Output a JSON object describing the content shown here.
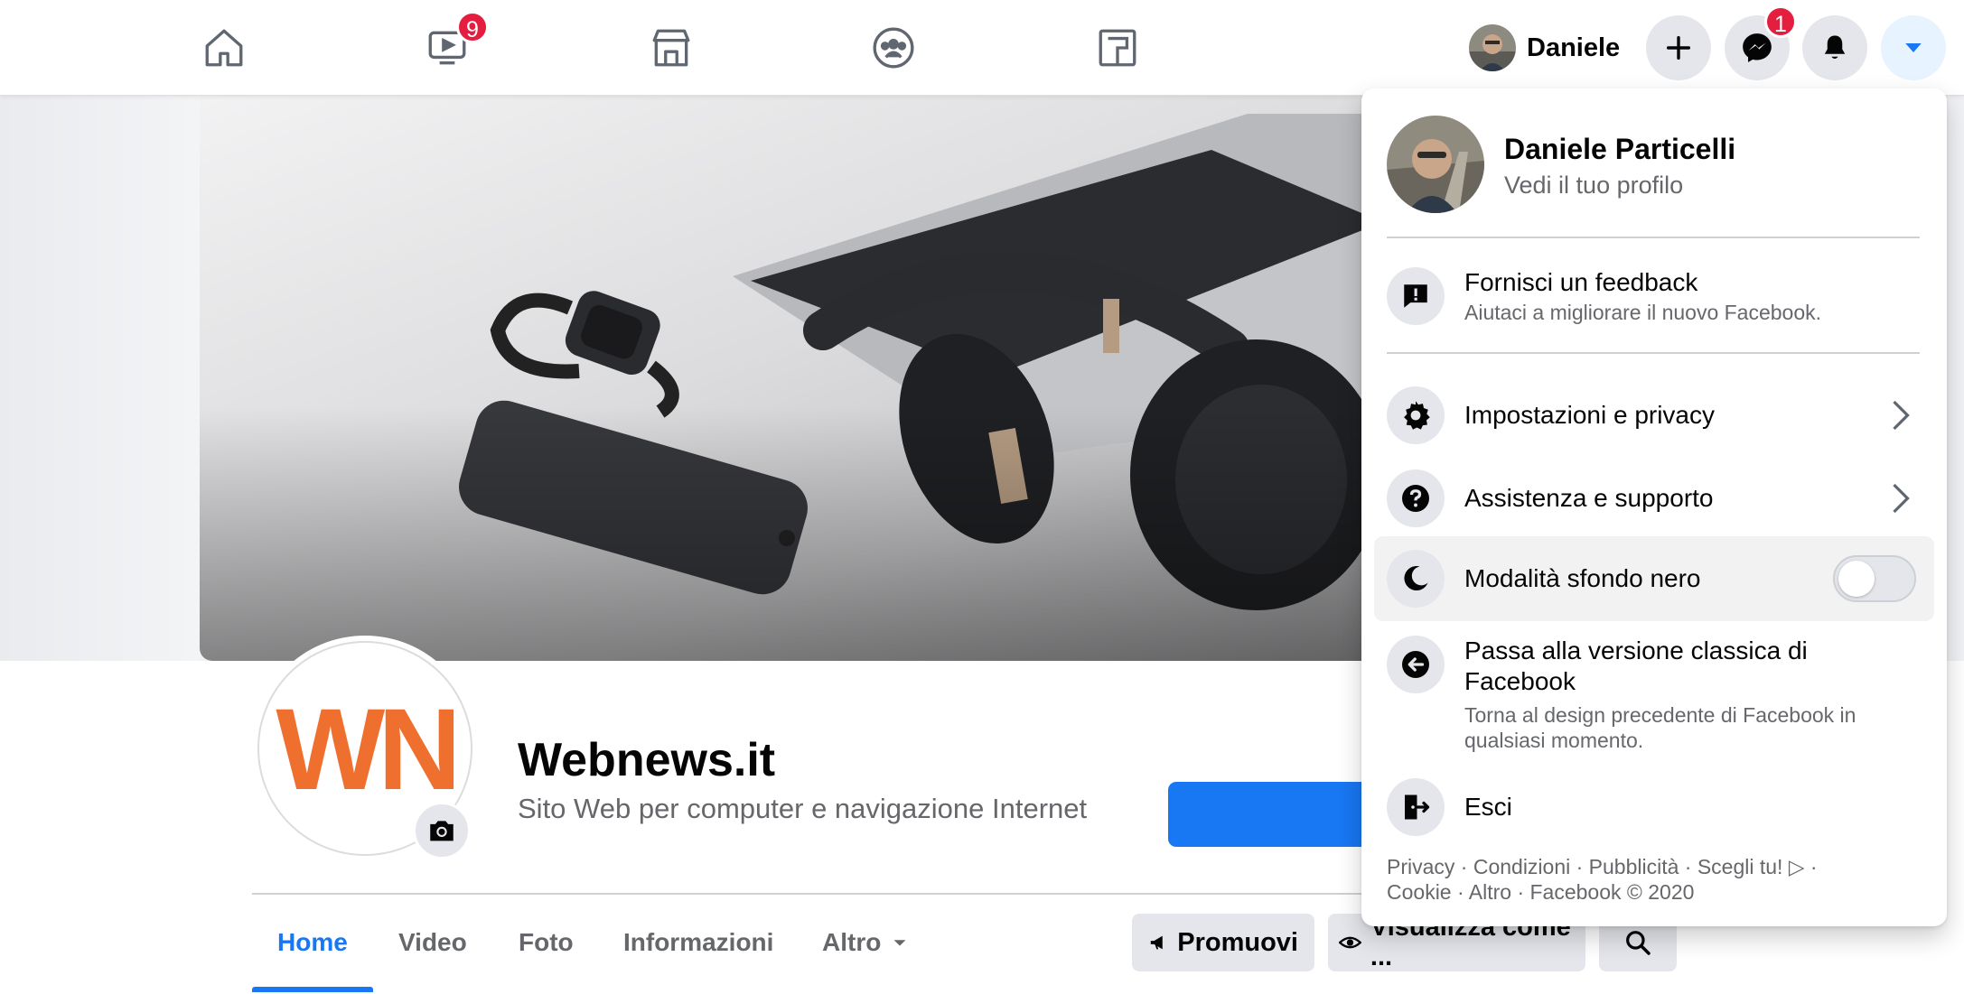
{
  "topbar": {
    "watch_badge": "9",
    "messenger_badge": "1",
    "user_name": "Daniele",
    "icons": [
      "home-icon",
      "watch-icon",
      "marketplace-icon",
      "groups-icon",
      "gaming-icon",
      "plus-icon",
      "messenger-icon",
      "bell-icon",
      "caret-down-icon"
    ]
  },
  "page": {
    "name": "Webnews.it",
    "category": "Sito Web per computer e navigazione Internet",
    "logo_text": "WN",
    "logo_color": "#ef6f2e",
    "tabs": [
      {
        "label": "Home",
        "active": true
      },
      {
        "label": "Video"
      },
      {
        "label": "Foto"
      },
      {
        "label": "Informazioni"
      },
      {
        "label": "Altro"
      }
    ],
    "actions": {
      "promote": "Promuovi",
      "view_as": "Visualizza come ..."
    }
  },
  "menu": {
    "profile_name": "Daniele Particelli",
    "profile_sub": "Vedi il tuo profilo",
    "feedback_title": "Fornisci un feedback",
    "feedback_sub": "Aiutaci a migliorare il nuovo Facebook.",
    "settings": "Impostazioni e privacy",
    "help": "Assistenza e supporto",
    "dark_mode": "Modalità sfondo nero",
    "dark_mode_on": false,
    "classic_title": "Passa alla versione classica di Facebook",
    "classic_sub": "Torna al design precedente di Facebook in qualsiasi momento.",
    "logout": "Esci",
    "footer_line1": "Privacy · Condizioni · Pubblicità · Scegli tu! ▷ ·",
    "footer_line2": "Cookie · Altro · Facebook © 2020"
  },
  "colors": {
    "accent": "#1877f2",
    "badge": "#e41e3f"
  }
}
